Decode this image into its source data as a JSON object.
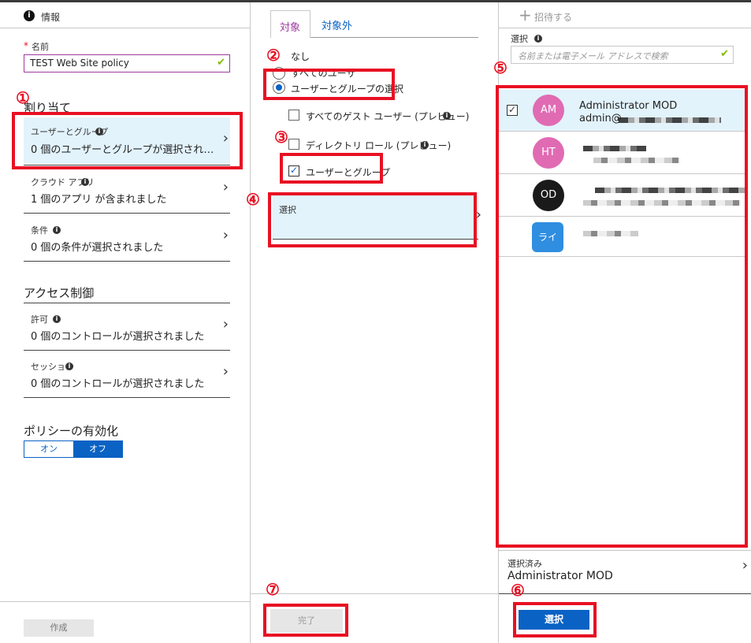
{
  "panel1": {
    "header": "情報",
    "name_label": "名前",
    "name_required": "*",
    "name_value": "TEST Web Site policy",
    "assign_heading": "割り当て",
    "users_groups": {
      "label": "ユーザーとグループ",
      "value": "0 個のユーザーとグループが選択され…"
    },
    "cloud_apps": {
      "label": "クラウド アプリ",
      "value": "1 個のアプリ が含まれました"
    },
    "conditions": {
      "label": "条件",
      "value": "0 個の条件が選択されました"
    },
    "access_heading": "アクセス制御",
    "grant": {
      "label": "許可",
      "value": "0 個のコントロールが選択されました"
    },
    "session": {
      "label": "セッション",
      "value": "0 個のコントロールが選択されました"
    },
    "enable_heading": "ポリシーの有効化",
    "toggle_on": "オン",
    "toggle_off": "オフ",
    "create_button": "作成"
  },
  "panel2": {
    "tab_include": "対象",
    "tab_exclude": "対象外",
    "option_none": "なし",
    "option_all_users": "すべてのユーザ",
    "option_select": "ユーザーとグループの選択",
    "check_guest": "すべてのゲスト ユーザー (プレビュー)",
    "check_directory_roles": "ディレクトリ ロール (プレビュー)",
    "check_users_groups": "ユーザーとグループ",
    "select_label": "選択",
    "done_button": "完了"
  },
  "panel3": {
    "invite": "招待する",
    "select_label": "選択",
    "search_placeholder": "名前または電子メール アドレスで検索",
    "users": [
      {
        "initials": "AM",
        "name": "Administrator MOD",
        "email": "admin@",
        "color": "#e06bb3",
        "checked": true
      },
      {
        "initials": "HT",
        "color": "#e06bb3",
        "checked": false
      },
      {
        "initials": "OD",
        "color": "#1a1a1a",
        "checked": false
      },
      {
        "initials": "ライ",
        "color": "#2f8ee0",
        "checked": false
      }
    ],
    "selected_label": "選択済み",
    "selected_value": "Administrator MOD",
    "select_button": "選択"
  },
  "annotations": [
    "①",
    "②",
    "③",
    "④",
    "⑤",
    "⑥",
    "⑦"
  ]
}
